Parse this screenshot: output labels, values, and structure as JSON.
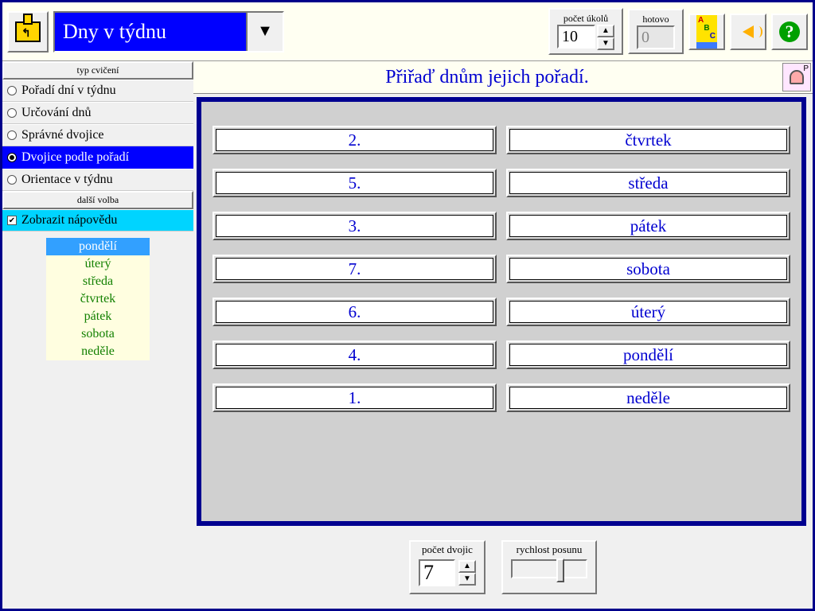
{
  "topbar": {
    "title": "Dny v týdnu",
    "tasks_label": "počet úkolů",
    "tasks_value": "10",
    "done_label": "hotovo",
    "done_value": "0",
    "help_symbol": "?",
    "home_arrow": "↰"
  },
  "sidebar": {
    "section1_header": "typ cvičení",
    "exercises": [
      {
        "label": "Pořadí dní v týdnu",
        "selected": false
      },
      {
        "label": "Určování dnů",
        "selected": false
      },
      {
        "label": "Správné dvojice",
        "selected": false
      },
      {
        "label": "Dvojice podle pořadí",
        "selected": true
      },
      {
        "label": "Orientace v týdnu",
        "selected": false
      }
    ],
    "section2_header": "další volba",
    "options": [
      {
        "label": "Zobrazit nápovědu",
        "checked": true
      }
    ],
    "hints": {
      "header": "pondělí",
      "rows": [
        "úterý",
        "středa",
        "čtvrtek",
        "pátek",
        "sobota",
        "neděle"
      ]
    }
  },
  "content": {
    "instruction": "Přiřaď dnům jejich pořadí.",
    "instr_badge": "P",
    "pairs": {
      "left": [
        "2.",
        "5.",
        "3.",
        "7.",
        "6.",
        "4.",
        "1."
      ],
      "right": [
        "čtvrtek",
        "středa",
        "pátek",
        "sobota",
        "úterý",
        "pondělí",
        "neděle"
      ]
    }
  },
  "bottom": {
    "pairs_label": "počet dvojic",
    "pairs_value": "7",
    "speed_label": "rychlost posunu"
  }
}
